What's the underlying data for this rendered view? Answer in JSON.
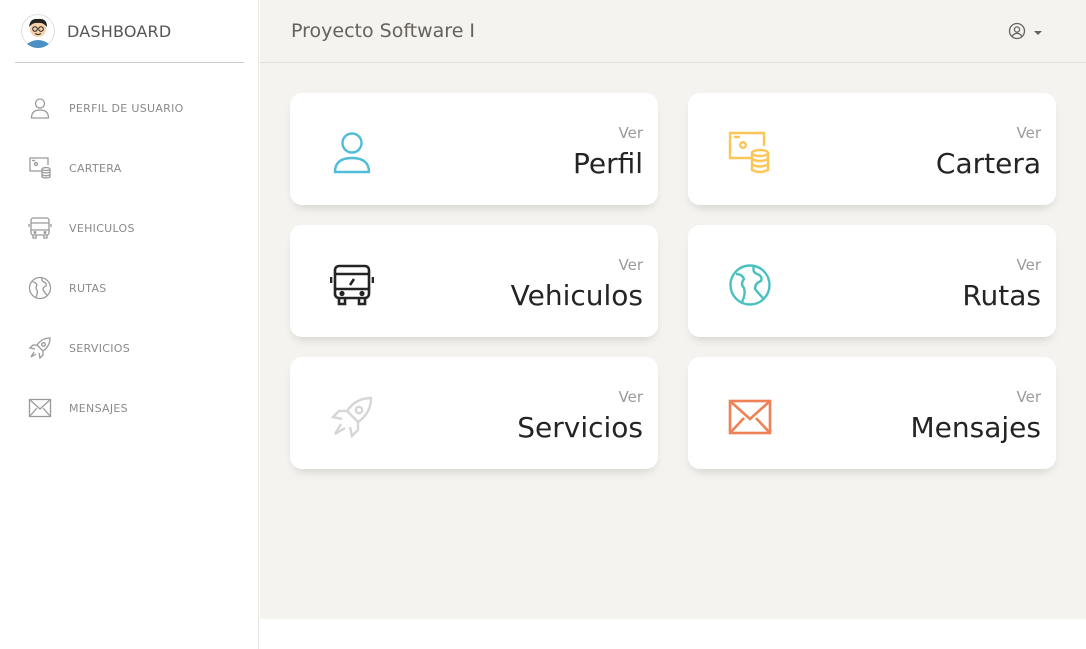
{
  "sidebar": {
    "brand": "DASHBOARD",
    "items": [
      {
        "label": "PERFIL DE USUARIO",
        "icon": "user-icon"
      },
      {
        "label": "CARTERA",
        "icon": "wallet-icon"
      },
      {
        "label": "VEHICULOS",
        "icon": "bus-icon"
      },
      {
        "label": "RUTAS",
        "icon": "globe-icon"
      },
      {
        "label": "SERVICIOS",
        "icon": "rocket-icon"
      },
      {
        "label": "MENSAJES",
        "icon": "mail-icon"
      }
    ]
  },
  "header": {
    "title": "Proyecto Software I",
    "user_icon": "user-circle-icon"
  },
  "cards": [
    {
      "small": "Ver",
      "big": "Perfil",
      "icon": "user-icon",
      "color": "#51bcda"
    },
    {
      "small": "Ver",
      "big": "Cartera",
      "icon": "wallet-icon",
      "color": "#fbc658"
    },
    {
      "small": "Ver",
      "big": "Vehiculos",
      "icon": "bus-icon",
      "color": "#252422"
    },
    {
      "small": "Ver",
      "big": "Rutas",
      "icon": "globe-icon",
      "color": "#4bc0c0"
    },
    {
      "small": "Ver",
      "big": "Servicios",
      "icon": "rocket-icon",
      "color": "#d6d6d6"
    },
    {
      "small": "Ver",
      "big": "Mensajes",
      "icon": "mail-icon",
      "color": "#ef8157"
    }
  ]
}
